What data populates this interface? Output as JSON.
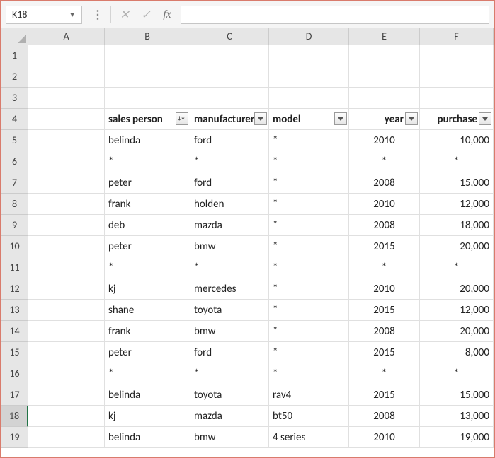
{
  "name_box": "K18",
  "formula_value": "",
  "columns": [
    "A",
    "B",
    "C",
    "D",
    "E",
    "F"
  ],
  "row_numbers": [
    1,
    2,
    3,
    4,
    5,
    6,
    7,
    8,
    9,
    10,
    11,
    12,
    13,
    14,
    15,
    16,
    17,
    18,
    19
  ],
  "active_row": 18,
  "headers": {
    "B": "sales person",
    "C": "manufacturer",
    "D": "model",
    "E": "year",
    "F": "purchase"
  },
  "header_sort": {
    "B": "asc"
  },
  "data_rows": [
    {
      "n": 5,
      "B": "belinda",
      "C": "ford",
      "D": "*",
      "E": "2010",
      "F": "10,000"
    },
    {
      "n": 6,
      "B": "*",
      "C": "*",
      "D": "*",
      "E": "*",
      "F": "*"
    },
    {
      "n": 7,
      "B": "peter",
      "C": "ford",
      "D": "*",
      "E": "2008",
      "F": "15,000"
    },
    {
      "n": 8,
      "B": "frank",
      "C": "holden",
      "D": "*",
      "E": "2010",
      "F": "12,000"
    },
    {
      "n": 9,
      "B": "deb",
      "C": "mazda",
      "D": "*",
      "E": "2008",
      "F": "18,000"
    },
    {
      "n": 10,
      "B": "peter",
      "C": "bmw",
      "D": "*",
      "E": "2015",
      "F": "20,000"
    },
    {
      "n": 11,
      "B": "*",
      "C": "*",
      "D": "*",
      "E": "*",
      "F": "*"
    },
    {
      "n": 12,
      "B": "kj",
      "C": "mercedes",
      "D": "*",
      "E": "2010",
      "F": "20,000"
    },
    {
      "n": 13,
      "B": "shane",
      "C": "toyota",
      "D": "*",
      "E": "2015",
      "F": "12,000"
    },
    {
      "n": 14,
      "B": "frank",
      "C": "bmw",
      "D": "*",
      "E": "2008",
      "F": "20,000"
    },
    {
      "n": 15,
      "B": "peter",
      "C": "ford",
      "D": "*",
      "E": "2015",
      "F": "8,000"
    },
    {
      "n": 16,
      "B": "*",
      "C": "*",
      "D": "*",
      "E": "*",
      "F": "*"
    },
    {
      "n": 17,
      "B": "belinda",
      "C": "toyota",
      "D": "rav4",
      "E": "2015",
      "F": "15,000"
    },
    {
      "n": 18,
      "B": "kj",
      "C": "mazda",
      "D": "bt50",
      "E": "2008",
      "F": "13,000"
    },
    {
      "n": 19,
      "B": "belinda",
      "C": "bmw",
      "D": "4 series",
      "E": "2010",
      "F": "19,000"
    }
  ]
}
